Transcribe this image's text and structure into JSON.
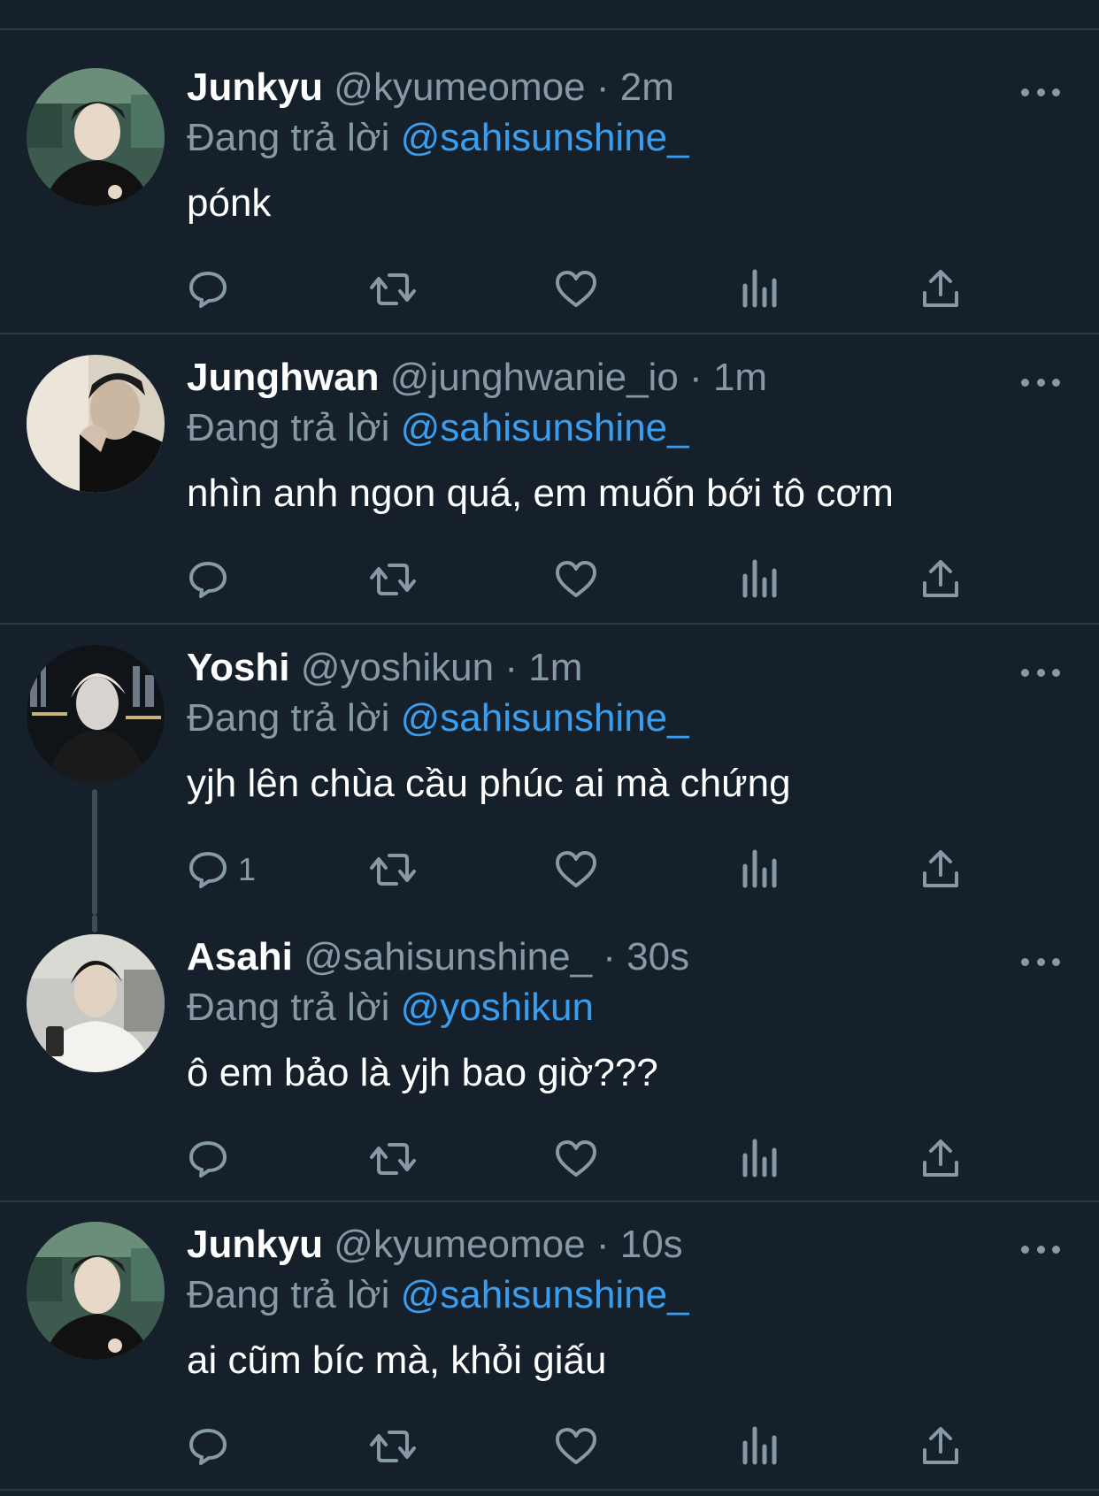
{
  "colors": {
    "background": "#15202b",
    "text": "#ffffff",
    "muted": "#8899a6",
    "mention": "#3a9ef0",
    "divider": "#2a3844"
  },
  "reply_prefix": "Đang trả lời",
  "separator": "·",
  "tweets": [
    {
      "name": "Junkyu",
      "handle": "@kyumeomoe",
      "time": "2m",
      "reply_to": "@sahisunshine_",
      "text": "pónk",
      "reply_count": ""
    },
    {
      "name": "Junghwan",
      "handle": "@junghwanie_io",
      "time": "1m",
      "reply_to": "@sahisunshine_",
      "text": "nhìn anh ngon quá, em muốn bới tô cơm",
      "reply_count": ""
    },
    {
      "name": "Yoshi",
      "handle": "@yoshikun",
      "time": "1m",
      "reply_to": "@sahisunshine_",
      "text": "yjh lên chùa cầu phúc ai mà chứng",
      "reply_count": "1"
    },
    {
      "name": "Asahi",
      "handle": "@sahisunshine_",
      "time": "30s",
      "reply_to": "@yoshikun",
      "text": "ô em bảo là yjh bao giờ???",
      "reply_count": ""
    },
    {
      "name": "Junkyu",
      "handle": "@kyumeomoe",
      "time": "10s",
      "reply_to": "@sahisunshine_",
      "text": "ai cũm bíc mà, khỏi giấu",
      "reply_count": ""
    }
  ]
}
